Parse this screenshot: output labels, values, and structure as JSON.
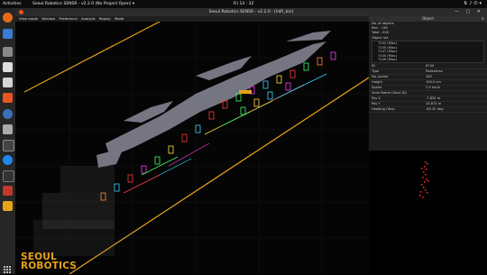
{
  "topbar": {
    "activities": "Activities",
    "app": "Seoul Robotics SENSR - v2.2.0 (No Project Open) ▾",
    "clock": "Fri 14 : 32"
  },
  "window": {
    "title": "Seoul Robotics SENSR - v2.2.0 - [lidR_bin]"
  },
  "menu": [
    "View mode",
    "Window",
    "Preference",
    "Analysis",
    "Replay",
    "Mode"
  ],
  "logo": {
    "line1": "SEOUL",
    "line2": "ROBOTICS"
  },
  "panel": {
    "title": "Object",
    "no_of_objects_label": "No. of objects",
    "ped": "Ped. : 165",
    "total": "Total : 228",
    "object_list_label": "Object list",
    "objects": [
      "7152 (Misc)",
      "7155 (Misc)",
      "7147 (Misc)",
      "7145 (Misc)",
      "7149 (Misc)"
    ],
    "fields": [
      {
        "k": "ID",
        "v": "6744"
      },
      {
        "k": "Type",
        "v": "Pedestrian"
      },
      {
        "k": "No. points",
        "v": "185"
      },
      {
        "k": "Height",
        "v": "190.0 cm"
      },
      {
        "k": "Speed",
        "v": "2.9 km/h"
      },
      {
        "k": "Zone Name (Zone ID)",
        "v": ""
      },
      {
        "k": "Pos X",
        "v": "-7.834 m"
      },
      {
        "k": "Pos Y",
        "v": "10.873 m"
      },
      {
        "k": "Heading (Yaw)",
        "v": "-80.32 deg"
      }
    ]
  },
  "colors": {
    "accent": "#e6a21b",
    "ubuntu": "#e95420"
  }
}
